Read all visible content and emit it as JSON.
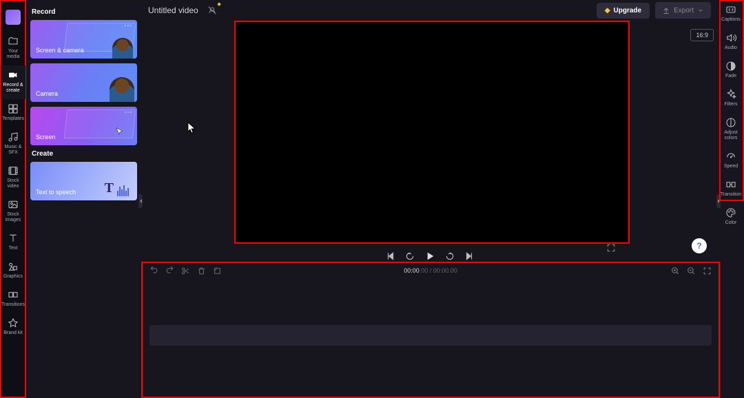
{
  "header": {
    "title": "Untitled video",
    "upgrade_label": "Upgrade",
    "export_label": "Export",
    "aspect_label": "16:9"
  },
  "leftnav": {
    "items": [
      {
        "label": "Your media",
        "icon": "folder"
      },
      {
        "label": "Record & create",
        "icon": "camera",
        "active": true
      },
      {
        "label": "Templates",
        "icon": "templates"
      },
      {
        "label": "Music & SFX",
        "icon": "music"
      },
      {
        "label": "Stock video",
        "icon": "film"
      },
      {
        "label": "Stock images",
        "icon": "image"
      },
      {
        "label": "Text",
        "icon": "text"
      },
      {
        "label": "Graphics",
        "icon": "graphics"
      },
      {
        "label": "Transitions",
        "icon": "transitions"
      },
      {
        "label": "Brand kit",
        "icon": "brand"
      }
    ]
  },
  "panel": {
    "record_head": "Record",
    "create_head": "Create",
    "cards": {
      "screen_camera": "Screen & camera",
      "camera": "Camera",
      "screen": "Screen",
      "tts": "Text to speech"
    }
  },
  "transport": {
    "current_time": "00:00",
    "current_frames": ".00",
    "sep": " / ",
    "total_time": "00:00",
    "total_frames": ".00"
  },
  "rightrail": {
    "items": [
      {
        "label": "Captions",
        "icon": "cc"
      },
      {
        "label": "Audio",
        "icon": "audio"
      },
      {
        "label": "Fade",
        "icon": "fade"
      },
      {
        "label": "Filters",
        "icon": "filters"
      },
      {
        "label": "Adjust colors",
        "icon": "adjust"
      },
      {
        "label": "Speed",
        "icon": "speed"
      },
      {
        "label": "Transition",
        "icon": "transition"
      },
      {
        "label": "Color",
        "icon": "color"
      }
    ]
  },
  "colors": {
    "highlight": "#ff0000",
    "bg": "#17161e"
  }
}
